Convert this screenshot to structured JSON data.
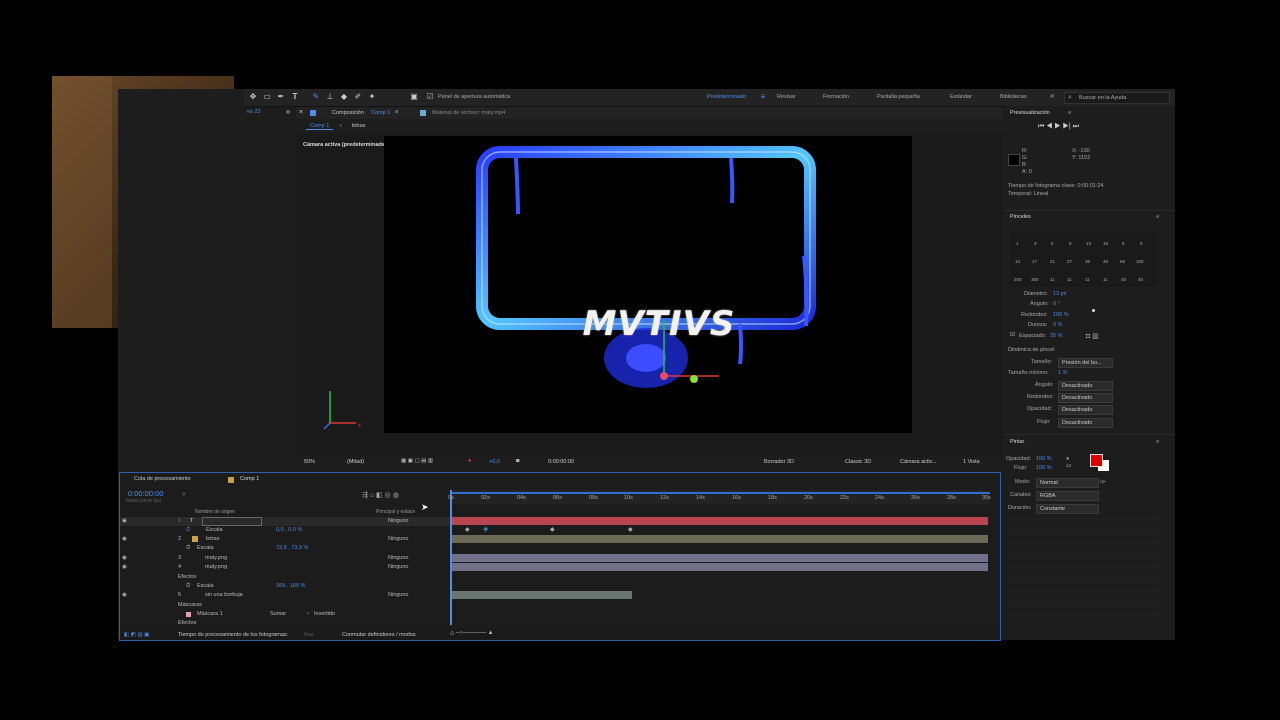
{
  "toolbar": {
    "auto_open_label": "Panel de apertura automática",
    "workspaces": [
      "Predeterminado",
      "Revisar",
      "Formación",
      "Pantalla pequeña",
      "Estándar",
      "Bibliotecas"
    ],
    "search_placeholder": "Buscar en la Ayuda",
    "expand_label": "»"
  },
  "comp_panel": {
    "tab_label": "Composición",
    "tab_name": "Comp 1",
    "footage_tab": "Material de archivo: maty.mp4",
    "breadcrumb": [
      "Comp 1",
      "letras"
    ],
    "camera_label": "Cámara activa (predeterminada)",
    "composition_text": "MVTIVS",
    "left_label": "es 23"
  },
  "viewer_bar": {
    "zoom": "50%",
    "resolution": "(Mitad)",
    "timecode": "0:00:00:00",
    "exposure": "+0,0",
    "renderer": "Borrador 3D",
    "view_mode": "Classic 3D",
    "camera": "Cámara activ...",
    "views": "1 Vista"
  },
  "timeline": {
    "tabs": [
      "Cola de procesamiento",
      "Comp 1"
    ],
    "timecode": "0:00:00:00",
    "fps": "00000 (29,97 fps)",
    "col_source": "Nombre de origen",
    "col_parent": "Principal y enlace",
    "ruler": [
      "0s",
      "02s",
      "04s",
      "06s",
      "08s",
      "10s",
      "12s",
      "14s",
      "16s",
      "18s",
      "20s",
      "22s",
      "24s",
      "26s",
      "28s",
      "30s"
    ],
    "layers": [
      {
        "num": "1",
        "name": "",
        "parent": "Ninguno"
      },
      {
        "num": "",
        "name": "Escala",
        "value": "0,0 , 0,0 %",
        "parent": ""
      },
      {
        "num": "2",
        "name": "letras",
        "parent": "Ninguno"
      },
      {
        "num": "",
        "name": "Escala",
        "value": "73,9 , 73,9 %",
        "parent": ""
      },
      {
        "num": "3",
        "name": "maty.png",
        "parent": "Ninguno"
      },
      {
        "num": "4",
        "name": "maty.png",
        "parent": "Ninguno"
      },
      {
        "num": "",
        "name": "Efectos",
        "value": "",
        "parent": ""
      },
      {
        "num": "",
        "name": "Escala",
        "value": "169 , 169 %",
        "parent": ""
      },
      {
        "num": "5",
        "name": "sin una borbuja",
        "parent": "Ninguno"
      },
      {
        "num": "",
        "name": "Máscaras",
        "value": "",
        "parent": ""
      },
      {
        "num": "",
        "name": "Máscara 1",
        "value": "",
        "parent": ""
      },
      {
        "num": "",
        "name": "Efectos",
        "value": "",
        "parent": ""
      }
    ],
    "mask_mode": "Sumar",
    "inverted_label": "Invertido",
    "footer_left": "Tiempo de procesamiento de los fotogramas:",
    "footer_ms": "7ms",
    "footer_toggle": "Conmutar definidores / modos"
  },
  "preview": {
    "title": "Previsualización",
    "color_labels": [
      "R:",
      "G:",
      "B:",
      "A: 0"
    ],
    "coords": [
      "X: -130",
      "Y: 1152"
    ],
    "keyframe_time": "Tiempo de fotograma clave: 0:00:01:24",
    "temporal": "Temporal: Lineal"
  },
  "brushes": {
    "title": "Pinceles",
    "sizes_row1": [
      "1",
      "3",
      "5",
      "9",
      "13",
      "19",
      "5",
      "9"
    ],
    "sizes_row2": [
      "13",
      "17",
      "21",
      "27",
      "35",
      "45",
      "65",
      "100"
    ],
    "sizes_row3": [
      "200",
      "300",
      "11",
      "11",
      "11",
      "11",
      "45",
      "45"
    ],
    "diameter_label": "Diámetro:",
    "diameter": "13 px",
    "angle_label": "Ángulo:",
    "angle": "0 °",
    "roundness_label": "Redondez:",
    "roundness": "100 %",
    "hardness_label": "Dureza:",
    "hardness": "0 %",
    "spacing_label": "Espaciado:",
    "spacing": "25 %",
    "dynamics_label": "Dinámica de pincel",
    "size_label": "Tamaño:",
    "size": "Presión del bo...",
    "min_size_label": "Tamaño mínimo:",
    "min_size": "1 %",
    "angle2_label": "Ángulo:",
    "angle2": "Desactivado",
    "roundness2_label": "Redondez:",
    "roundness2": "Desactivado",
    "opacity_label": "Opacidad:",
    "opacity": "Desactivado",
    "flow_label": "Flujo:",
    "flow": "Desactivado"
  },
  "paint": {
    "title": "Pintar",
    "opacity_label": "Opacidad:",
    "opacity": "100 %",
    "flow_label": "Flujo:",
    "flow": "100 %",
    "brush_size": "13",
    "mode_label": "Modo:",
    "mode": "Normal",
    "channels_label": "Canales:",
    "channels": "RGBA",
    "duration_label": "Duración:",
    "duration": "Constante",
    "fg_color": "#e00000",
    "bg_color": "#ffffff"
  }
}
